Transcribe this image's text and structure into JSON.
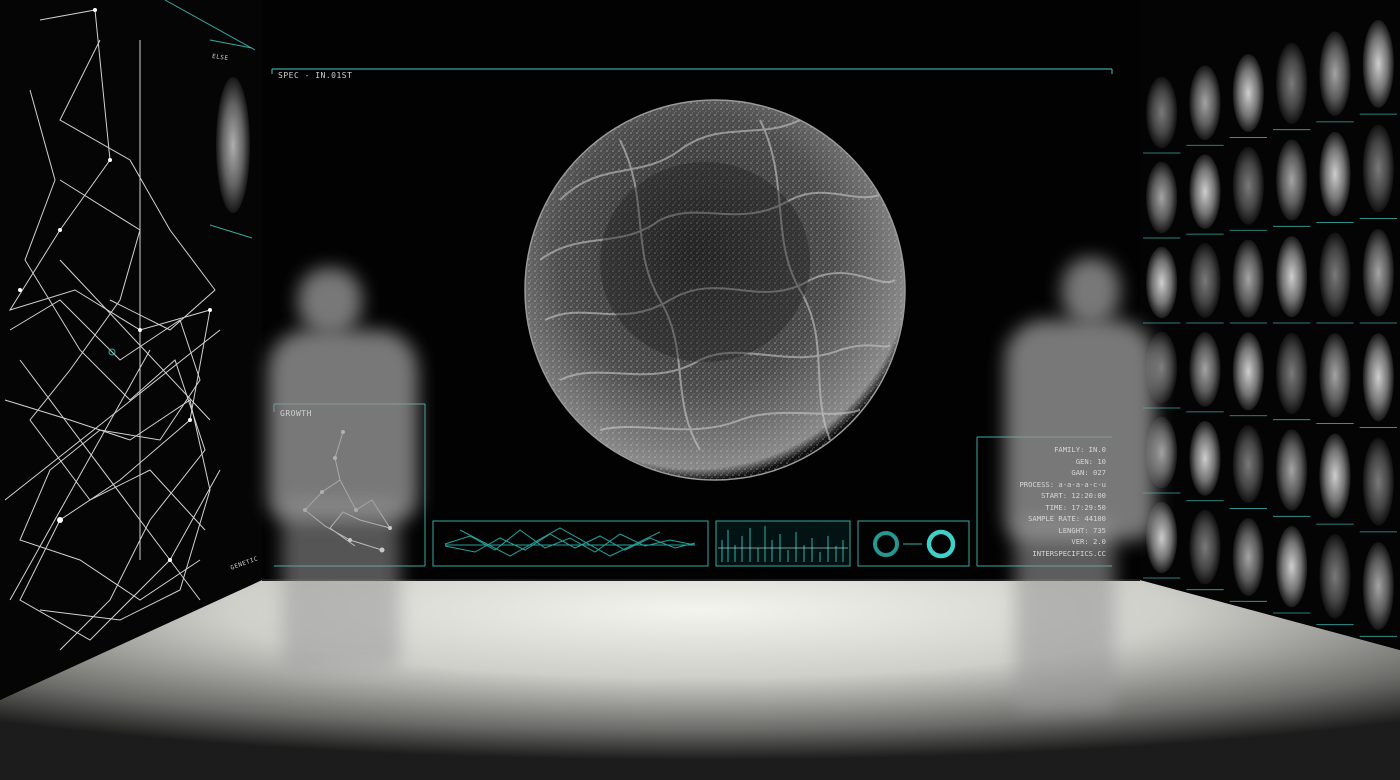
{
  "screen_title": "SPEC - IN.01ST",
  "left_wall_tag": "ELSE",
  "left_wall_caption": "GENETIC",
  "growth_label": "GROWTH",
  "info_panel": [
    "FAMILY: IN.0",
    "GEN: 10",
    "GAN: 027",
    "PROCESS: a-a-a-a-c-u",
    "START: 12:20:00",
    "TIME: 17:29:50",
    "SAMPLE RATE: 44100",
    "LENGHT: 735",
    "VER: 2.0",
    "INTERSPECIFICS.CC"
  ],
  "colors": {
    "accent": "#2bb3ab",
    "hud_line": "#3aa6a1",
    "sphere": "#bdbdbd",
    "floor": "#e9e9e4",
    "background": "#020202"
  },
  "icons": [
    "person-silhouette-left",
    "person-silhouette-right",
    "sphere-sculpture",
    "network-graph",
    "specimen-grid"
  ]
}
